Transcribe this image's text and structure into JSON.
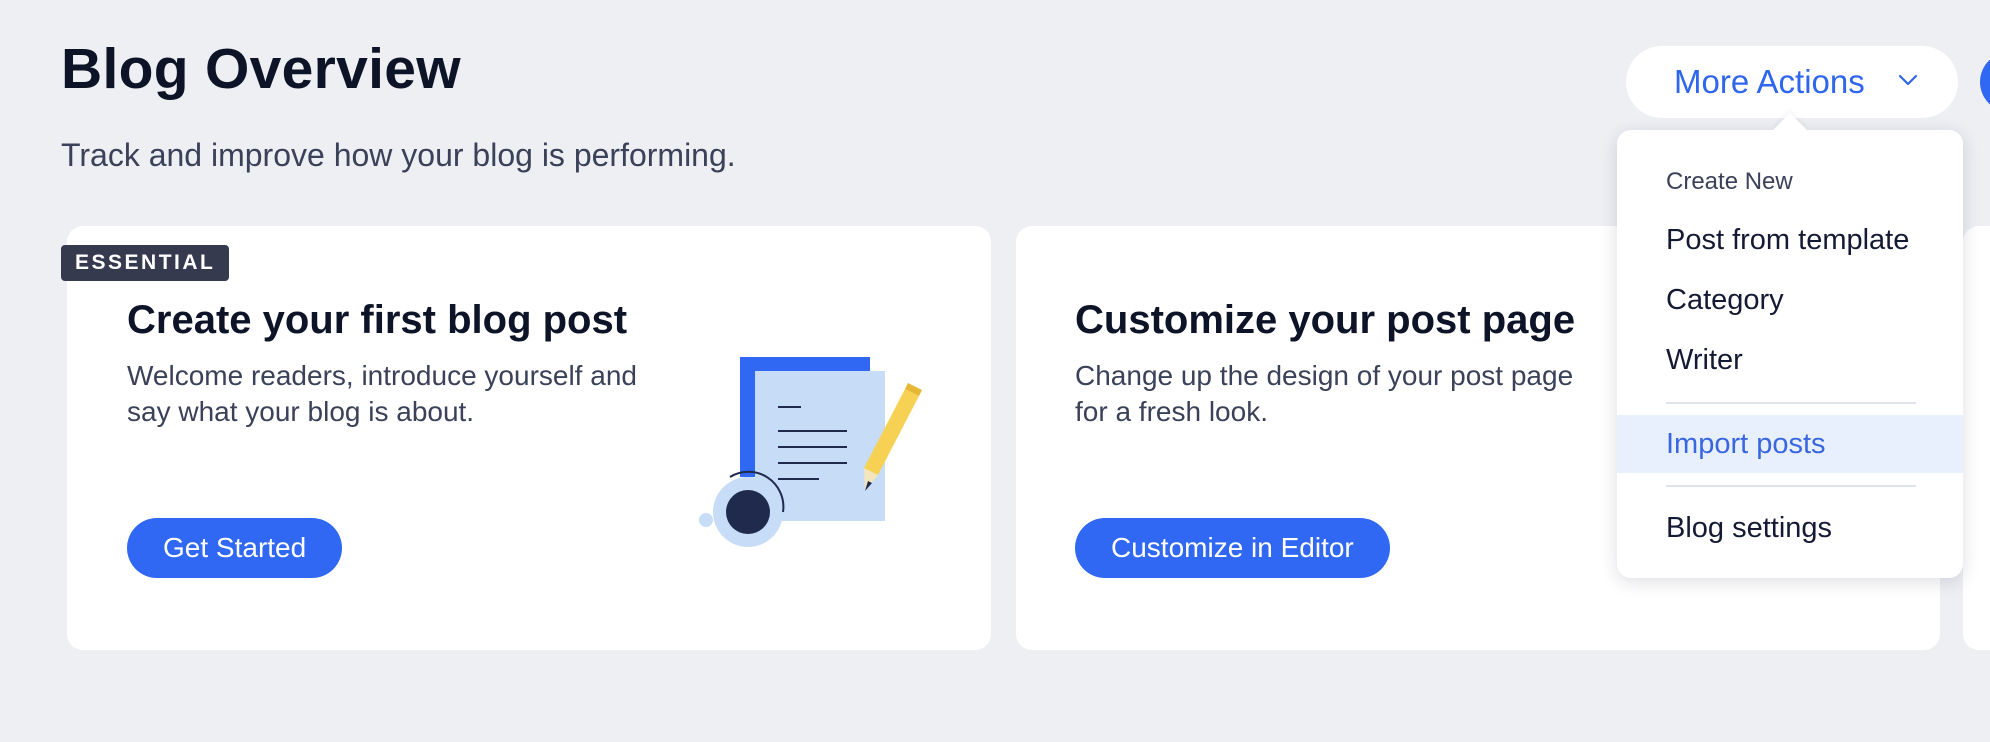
{
  "header": {
    "title": "Blog Overview",
    "subtitle": "Track and improve how your blog is performing.",
    "more_actions_label": "More Actions"
  },
  "cards": [
    {
      "badge": "ESSENTIAL",
      "title": "Create your first blog post",
      "description": "Welcome readers, introduce yourself and say what your blog is about.",
      "button_label": "Get Started"
    },
    {
      "title": "Customize your post page",
      "description": "Change up the design of your post page for a fresh look.",
      "button_label": "Customize in Editor"
    }
  ],
  "dropdown": {
    "section_header": "Create New",
    "items": [
      {
        "label": "Post from template"
      },
      {
        "label": "Category"
      },
      {
        "label": "Writer"
      },
      {
        "label": "Import posts",
        "highlighted": true
      },
      {
        "label": "Blog settings"
      }
    ]
  },
  "colors": {
    "accent": "#3068f3",
    "background": "#edeff3",
    "badge": "#353a4f",
    "highlight": "#e8f0fd",
    "pencil": "#f7d154"
  },
  "icons": [
    "chevron-down-icon",
    "document-illustration",
    "pencil-icon",
    "magnifier-icon"
  ]
}
